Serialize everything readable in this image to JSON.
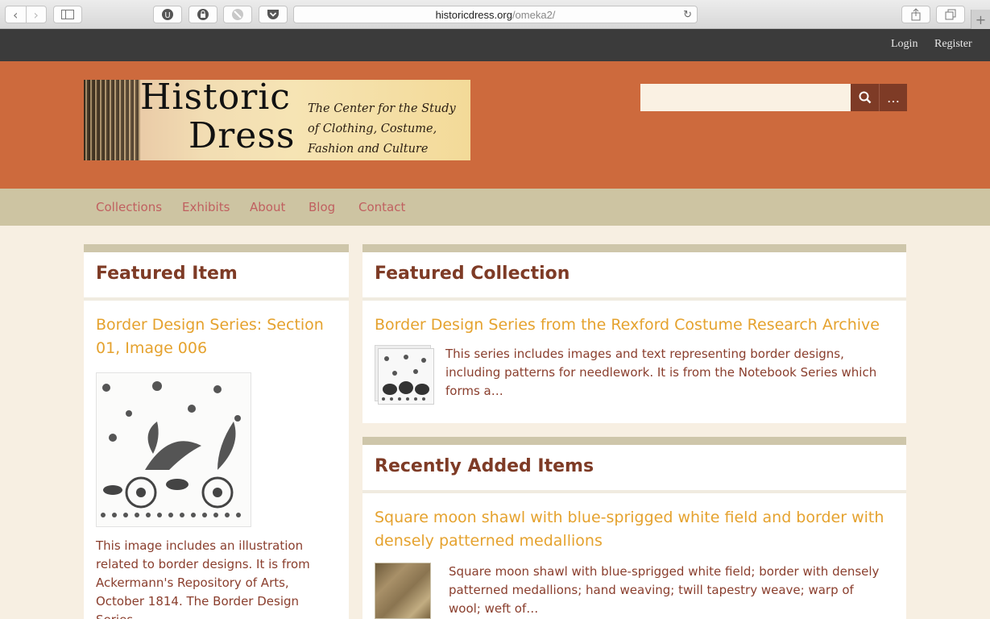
{
  "browser": {
    "url_domain": "historicdress.org",
    "url_path": "/omeka2/"
  },
  "userbar": {
    "login": "Login",
    "register": "Register"
  },
  "header": {
    "logo_title_line1": "Historic",
    "logo_title_line2": "Dress",
    "logo_subtitle": "The Center for the Study of Clothing, Costume, Fashion and Culture",
    "search_placeholder": "",
    "advanced_search_label": "…"
  },
  "nav": {
    "items": [
      "Collections",
      "Exhibits",
      "About",
      "Blog",
      "Contact"
    ]
  },
  "featured_item": {
    "heading": "Featured Item",
    "title": "Border Design Series: Section 01, Image 006",
    "description": "This image includes an illustration related to border designs. It is from Ackermann's Repository of Arts, October 1814. The Border Design Series…"
  },
  "featured_collection": {
    "heading": "Featured Collection",
    "title": "Border Design Series from the Rexford Costume Research Archive",
    "description": "This series includes images and text representing border designs, including patterns for needlework. It is from the Notebook Series which forms a…"
  },
  "recent_items": {
    "heading": "Recently Added Items",
    "title": "Square moon shawl with blue-sprigged white field and border with densely patterned medallions",
    "description": "Square moon shawl with blue-sprigged white field; border with densely patterned medallions; hand weaving; twill tapestry weave; warp of wool; weft of…"
  }
}
